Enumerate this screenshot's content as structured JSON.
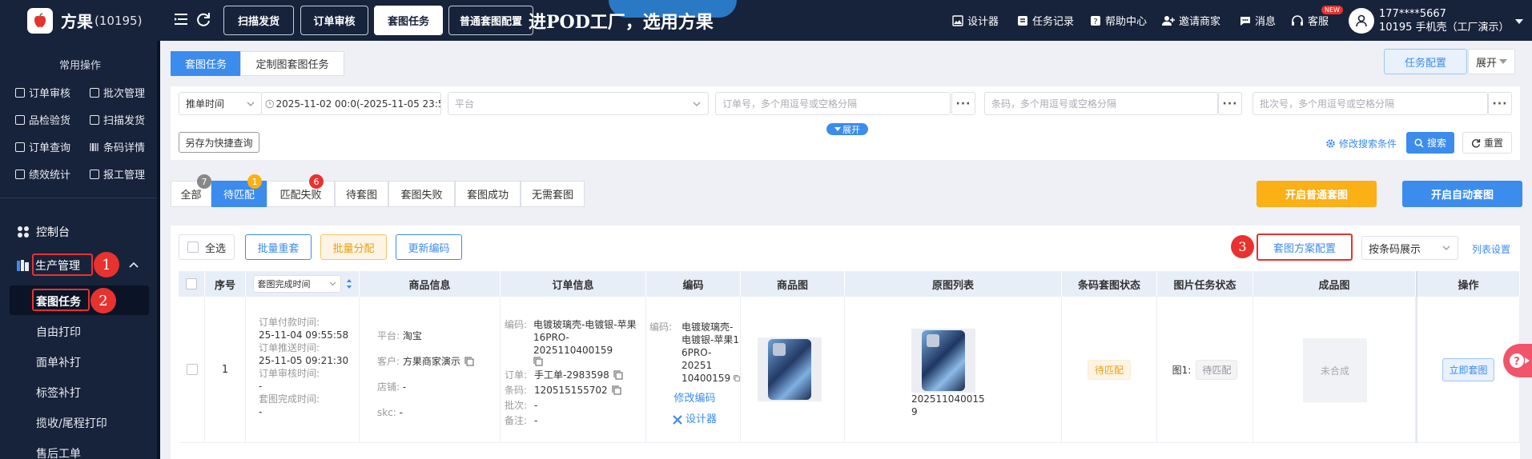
{
  "app": {
    "name": "方果",
    "count": "(10195)"
  },
  "banner": "进POD工厂，选用方果",
  "topbar": {
    "buttons": [
      "扫描发货",
      "订单审核",
      "套图任务",
      "普通套图配置"
    ],
    "right": [
      "设计器",
      "任务记录",
      "帮助中心",
      "邀请商家",
      "消息",
      "客服"
    ],
    "new_badge": "NEW",
    "user_phone": "177****5667",
    "user_name": "10195 手机壳（工厂演示）"
  },
  "sidebar": {
    "section_title": "常用操作",
    "quick": [
      "订单审核",
      "批次管理",
      "品检验货",
      "扫描发货",
      "订单查询",
      "条码详情",
      "绩效统计",
      "报工管理"
    ],
    "dashboard": "控制台",
    "production": "生产管理",
    "sub": [
      "套图任务",
      "自由打印",
      "面单补打",
      "标签补打",
      "揽收/尾程打印",
      "售后工单"
    ]
  },
  "markers": [
    "1",
    "2",
    "3"
  ],
  "tabs": {
    "task": "套图任务",
    "custom": "定制图套图任务"
  },
  "top_actions": {
    "config": "任务配置",
    "expand": "展开"
  },
  "filters": {
    "time_type": "推单时间",
    "date_range": "2025-11-02 00:0(-2025-11-05 23:5(",
    "platform_placeholder": "平台",
    "order_placeholder": "订单号，多个用逗号或空格分隔",
    "barcode_placeholder": "条码，多个用逗号或空格分隔",
    "batch_placeholder": "批次号，多个用逗号或空格分隔",
    "expand": "展开",
    "save_quick": "另存为快捷查询",
    "modify": "修改搜索条件",
    "search": "搜索",
    "reset": "重置"
  },
  "status_tabs": [
    {
      "label": "全部",
      "count": "7"
    },
    {
      "label": "待匹配",
      "count": "1"
    },
    {
      "label": "匹配失败",
      "count": "6"
    },
    {
      "label": "待套图",
      "count": ""
    },
    {
      "label": "套图失败",
      "count": ""
    },
    {
      "label": "套图成功",
      "count": ""
    },
    {
      "label": "无需套图",
      "count": ""
    }
  ],
  "actions": {
    "normal": "开启普通套图",
    "auto": "开启自动套图"
  },
  "toolbar": {
    "select_all": "全选",
    "batch_redo": "批量重套",
    "batch_assign": "批量分配",
    "update_code": "更新编码",
    "scheme": "套图方案配置",
    "display": "按条码展示",
    "columns": "列表设置"
  },
  "table": {
    "headers": [
      "序号",
      "套图完成时间",
      "商品信息",
      "订单信息",
      "编码",
      "商品图",
      "原图列表",
      "条码套图状态",
      "图片任务状态",
      "成品图",
      "操作"
    ],
    "row": {
      "index": "1",
      "pay_time_label": "订单付款时间:",
      "pay_time": "25-11-04 09:55:58",
      "push_time_label": "订单推送时间:",
      "push_time": "25-11-05 09:21:30",
      "audit_label": "订单审核时间:",
      "audit_val": "-",
      "done_label": "套图完成时间:",
      "done_val": "-",
      "platform_label": "平台:",
      "platform": "淘宝",
      "customer_label": "客户:",
      "customer": "方果商家演示",
      "shop_label": "店铺:",
      "shop": "-",
      "skc_label": "skc:",
      "skc": "-",
      "code_label": "编码:",
      "code_l1": "电镀玻璃壳-电镀银-苹果",
      "code_l2": "16PRO-2025110400159",
      "order_label": "订单:",
      "order": "手工单-2983598",
      "barcode_label": "条码:",
      "barcode": "120515155702",
      "batch_label": "批次:",
      "batch": "-",
      "note_label": "备注:",
      "note": "-",
      "code2_label": "编码:",
      "code2_l1": "电镀玻璃壳-",
      "code2_l2": "电镀银-苹果1",
      "code2_l3": "6PRO-20251",
      "code2_l4": "10400159",
      "edit_code": "修改编码",
      "designer": "设计器",
      "orig_name_l1": "202511040015",
      "orig_name_l2": "9",
      "barcode_status": "待匹配",
      "img_task_label": "图1:",
      "img_task_status": "待匹配",
      "product_img": "未合成",
      "action": "立即套图"
    }
  },
  "colors": {
    "nav": "#17233b",
    "primary": "#3b8ced",
    "orange": "#fbb016",
    "red": "#e8322f"
  }
}
